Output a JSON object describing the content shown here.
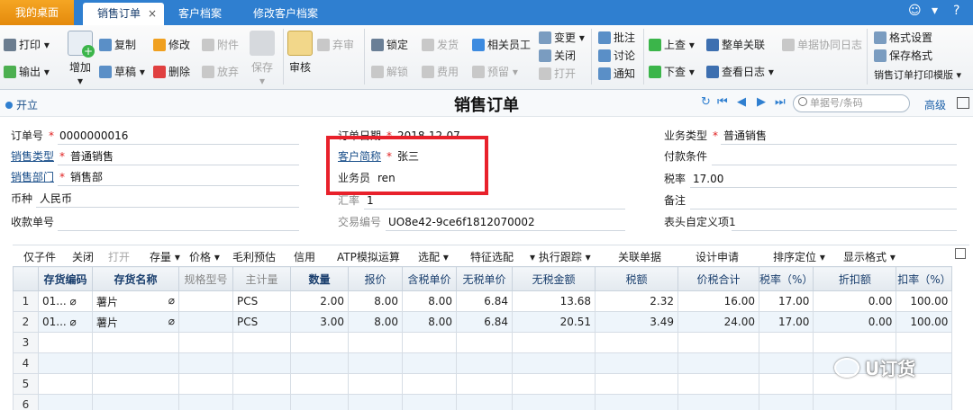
{
  "tabs": {
    "home": "我的桌面",
    "active": "销售订单",
    "close": "×",
    "customer_file": "客户档案",
    "edit_customer_file": "修改客户档案"
  },
  "window_icons": {
    "smile": "☺",
    "down": "▾",
    "help": "?"
  },
  "ribbon": {
    "print": "打印",
    "export": "输出",
    "add": "增加",
    "copy": "复制",
    "draft": "草稿",
    "modify": "修改",
    "delete": "删除",
    "attachment": "附件",
    "abandon": "放弃",
    "save": "保存",
    "audit": "审核",
    "discard": "弃审",
    "lock": "锁定",
    "unlock": "解锁",
    "ship": "发货",
    "expense": "费用",
    "related_staff": "相关员工",
    "reserve": "预留",
    "change": "变更",
    "close": "关闭",
    "open": "打开",
    "approve": "批注",
    "discuss": "讨论",
    "notify": "通知",
    "prev": "上查",
    "next": "下查",
    "whole_link": "整单关联",
    "view_log": "查看日志",
    "doc_collab_log": "单据协同日志",
    "format_settings": "格式设置",
    "save_format": "保存格式",
    "print_template": "销售订单打印模版"
  },
  "titlebar": {
    "open_label": "开立",
    "title": "销售订单",
    "search_placeholder": "单据号/条码",
    "advanced": "高级"
  },
  "header": {
    "order_no_label": "订单号",
    "order_no": "0000000016",
    "order_date_label": "订单日期",
    "order_date": "2018-12-07",
    "biz_type_label": "业务类型",
    "biz_type": "普通销售",
    "sales_type_label": "销售类型",
    "sales_type": "普通销售",
    "customer_label": "客户简称",
    "customer": "张三",
    "payment_terms_label": "付款条件",
    "sales_dept_label": "销售部门",
    "sales_dept": "销售部",
    "salesperson_label": "业务员",
    "salesperson": "ren",
    "tax_rate_label": "税率",
    "tax_rate": "17.00",
    "currency_label": "币种",
    "currency": "人民币",
    "exchange_rate_label": "汇率",
    "exchange_rate": "1",
    "remark_label": "备注",
    "receipt_no_label": "收款单号",
    "trade_no_label": "交易编号",
    "trade_no": "UO8e42-9ce6f1812070002",
    "custom_header_label": "表头自定义项1"
  },
  "body_toolbar": {
    "components": "仅子件",
    "close": "关闭",
    "open": "打开",
    "stock": "存量",
    "price": "价格",
    "gross_profit": "毛利预估",
    "credit": "信用",
    "atp": "ATP模拟运算",
    "match": "选配",
    "feature_match": "特征选配",
    "trace": "执行跟踪",
    "related_docs": "关联单据",
    "design_request": "设计申请",
    "sort_locate": "排序定位",
    "display_format": "显示格式"
  },
  "grid": {
    "columns": [
      "",
      "存货编码",
      "存货名称",
      "规格型号",
      "主计量",
      "数量",
      "报价",
      "含税单价",
      "无税单价",
      "无税金额",
      "税额",
      "价税合计",
      "税率（%）",
      "折扣额",
      "扣率（%）"
    ],
    "rows": [
      {
        "n": "1",
        "code": "01...",
        "name": "薯片",
        "unit": "PCS",
        "qty": "2.00",
        "quote": "8.00",
        "tax_price": "8.00",
        "net_price": "6.84",
        "net_amount": "13.68",
        "tax": "2.32",
        "total": "16.00",
        "rate": "17.00",
        "discount": "0.00",
        "disc_rate": "100.00"
      },
      {
        "n": "2",
        "code": "01...",
        "name": "薯片",
        "unit": "PCS",
        "qty": "3.00",
        "quote": "8.00",
        "tax_price": "8.00",
        "net_price": "6.84",
        "net_amount": "20.51",
        "tax": "3.49",
        "total": "24.00",
        "rate": "17.00",
        "discount": "0.00",
        "disc_rate": "100.00"
      }
    ],
    "empty_rows": [
      "3",
      "4",
      "5",
      "6"
    ]
  },
  "watermark": "U订货",
  "colors": {
    "tabbar": "#2f7fd0",
    "home_tab": "#f5a623",
    "highlight_box": "#e8212b"
  }
}
